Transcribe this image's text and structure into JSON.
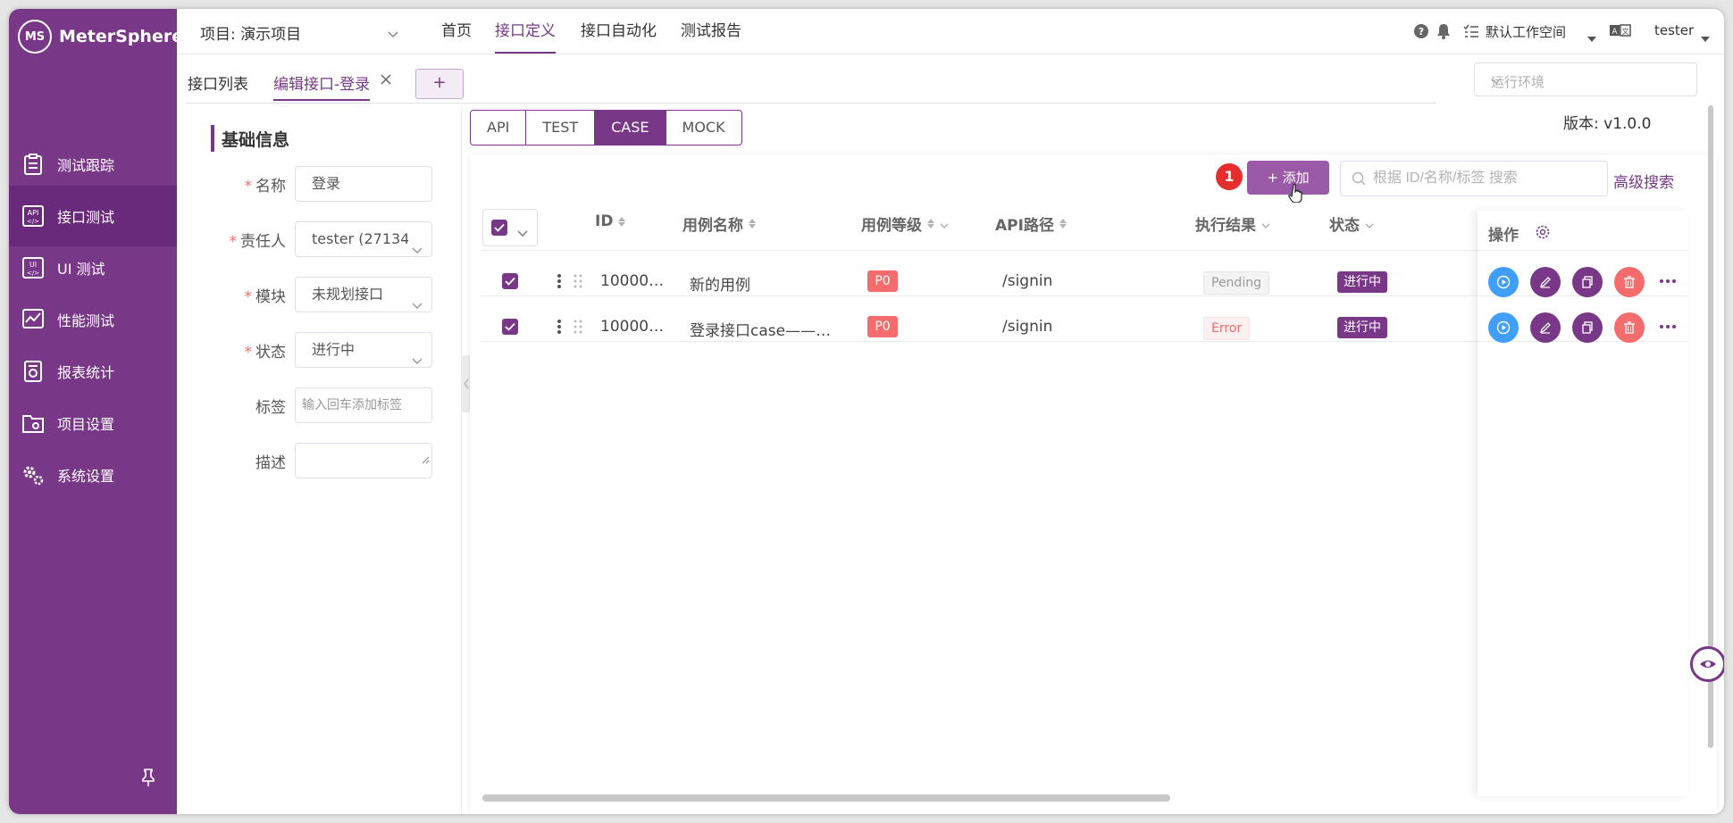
{
  "app": {
    "name": "MeterSphere",
    "logo_mark": "MS"
  },
  "sidebar": {
    "items": [
      {
        "label": "测试跟踪",
        "icon": "clipboard-icon"
      },
      {
        "label": "接口测试",
        "icon": "api-icon",
        "active": true
      },
      {
        "label": "UI 测试",
        "icon": "ui-icon"
      },
      {
        "label": "性能测试",
        "icon": "performance-chart-icon"
      },
      {
        "label": "报表统计",
        "icon": "report-icon"
      },
      {
        "label": "项目设置",
        "icon": "folder-settings-icon"
      },
      {
        "label": "系统设置",
        "icon": "gears-icon"
      }
    ]
  },
  "header": {
    "project": "项目: 演示项目",
    "nav": [
      "首页",
      "接口定义",
      "接口自动化",
      "测试报告"
    ],
    "active_nav": "接口定义",
    "workspace": "默认工作空间",
    "user": "tester"
  },
  "tabs": {
    "list_label": "接口列表",
    "edit_label": "编辑接口-登录",
    "add_symbol": "+"
  },
  "env": {
    "placeholder": "运行环境"
  },
  "version": "版本: v1.0.0",
  "form": {
    "title": "基础信息",
    "name_label": "名称",
    "name_value": "登录",
    "owner_label": "责任人",
    "owner_value": "tester (27134",
    "module_label": "模块",
    "module_value": "未规划接口",
    "status_label": "状态",
    "status_value": "进行中",
    "tag_label": "标签",
    "tag_placeholder": "输入回车添加标签",
    "desc_label": "描述"
  },
  "case_tabs": [
    "API",
    "TEST",
    "CASE",
    "MOCK"
  ],
  "toolbar": {
    "step_number": "1",
    "add_label": "+ 添加",
    "search_placeholder": "根据 ID/名称/标签 搜索",
    "advanced_search": "高级搜索"
  },
  "table": {
    "headers": {
      "id": "ID",
      "name": "用例名称",
      "level": "用例等级",
      "path": "API路径",
      "result": "执行结果",
      "status": "状态",
      "ops": "操作"
    },
    "rows": [
      {
        "id": "10000…",
        "name": "新的用例",
        "level": "P0",
        "path": "/signin",
        "result": "Pending",
        "status": "进行中"
      },
      {
        "id": "10000…",
        "name": "登录接口case——…",
        "level": "P0",
        "path": "/signin",
        "result": "Error",
        "status": "进行中"
      }
    ]
  },
  "colors": {
    "brand": "#783887",
    "danger": "#f56c6c",
    "primary": "#409eff"
  }
}
